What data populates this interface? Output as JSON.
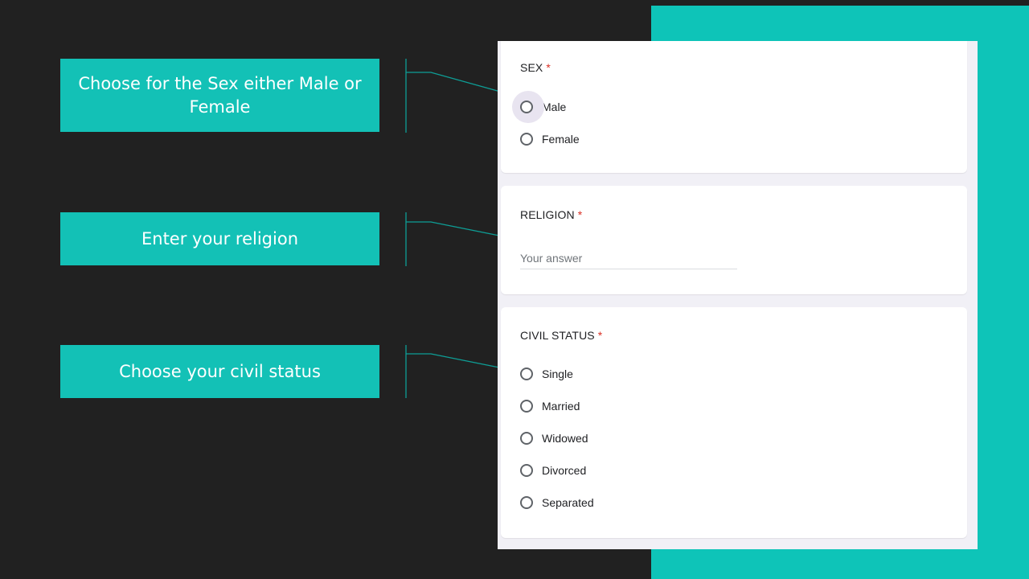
{
  "callouts": {
    "sex": "Choose for the Sex either Male or Female",
    "religion": "Enter your religion",
    "civil_status": "Choose your civil status"
  },
  "form": {
    "sex": {
      "title": "SEX",
      "required_marker": "*",
      "options": [
        "Male",
        "Female"
      ]
    },
    "religion": {
      "title": "RELIGION",
      "required_marker": "*",
      "placeholder": "Your answer"
    },
    "civil_status": {
      "title": "CIVIL STATUS",
      "required_marker": "*",
      "options": [
        "Single",
        "Married",
        "Widowed",
        "Divorced",
        "Separated"
      ]
    }
  },
  "colors": {
    "accent_teal": "#13c1b6",
    "background": "#212121",
    "required": "#d93025"
  }
}
